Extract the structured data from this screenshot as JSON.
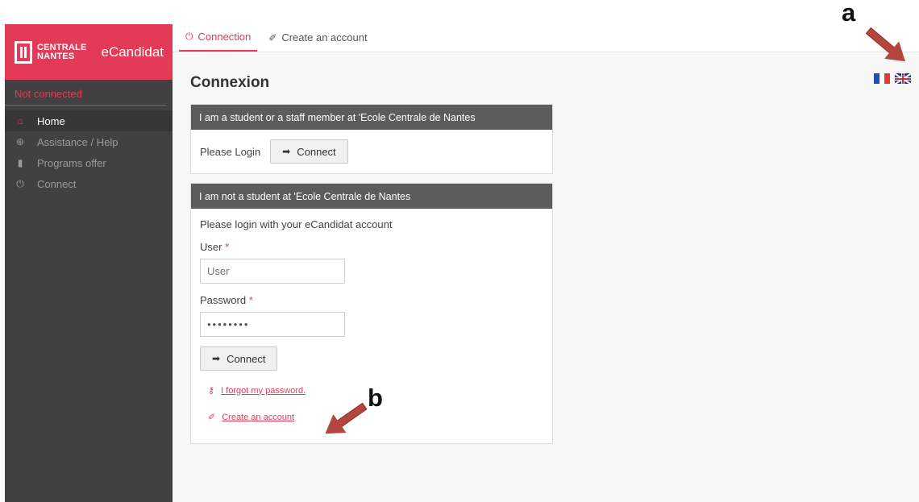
{
  "sidebar": {
    "brand_top": "CENTRALE",
    "brand_bottom": "NANTES",
    "app_name": "eCandidat",
    "status": "Not connected",
    "items": [
      {
        "label": "Home",
        "icon": "home-icon",
        "glyph": "⌂"
      },
      {
        "label": "Assistance / Help",
        "icon": "lifebuoy-icon",
        "glyph": "⊕"
      },
      {
        "label": "Programs offer",
        "icon": "bookmark-icon",
        "glyph": "▮"
      },
      {
        "label": "Connect",
        "icon": "power-icon",
        "glyph": "⏻"
      }
    ]
  },
  "topbar": {
    "tabs": [
      {
        "label": "Connection",
        "icon": "power-icon",
        "glyph": "⏻"
      },
      {
        "label": "Create an account",
        "icon": "wand-icon",
        "glyph": "✐"
      }
    ]
  },
  "main": {
    "title": "Connexion",
    "panel_student": {
      "heading": "I am a student or a staff member at 'Ecole Centrale de Nantes",
      "prompt": "Please Login",
      "button": "Connect"
    },
    "panel_external": {
      "heading": "I am not a student at 'Ecole Centrale de Nantes",
      "intro": "Please login with your eCandidat account",
      "user_label": "User",
      "user_placeholder": "User",
      "password_label": "Password",
      "password_value": "••••••••",
      "required_mark": "*",
      "button": "Connect",
      "forgot_link": "I forgot my password.",
      "create_link": "Create an account"
    }
  },
  "annotations": {
    "a": "a",
    "b": "b"
  },
  "colors": {
    "accent": "#e33b57",
    "sidebar_bg": "#414141",
    "panel_head": "#5c5c5c",
    "arrow": "#b5453f"
  }
}
